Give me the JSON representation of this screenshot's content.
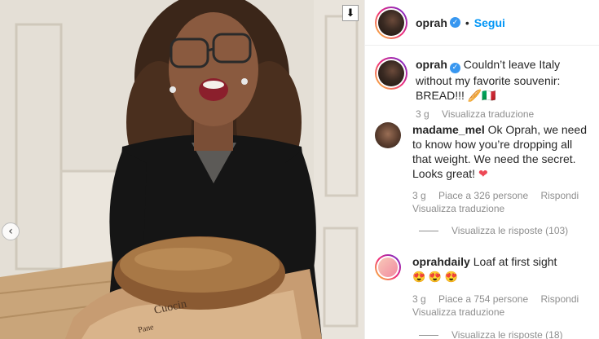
{
  "photo": {
    "prev_icon": "chevron-left-icon",
    "download_icon": "download-arrow-icon",
    "prev_glyph": "‹",
    "download_glyph": "⬇",
    "bag_text": "Cuocin",
    "bag_text2": "Pane"
  },
  "header": {
    "username": "oprah",
    "verified_glyph": "✓",
    "separator": "•",
    "follow_label": "Segui"
  },
  "caption": {
    "username": "oprah",
    "text": "Couldn’t leave Italy without my favorite souvenir: BREAD!!! 🥖🇮🇹",
    "time": "3 g",
    "translate": "Visualizza traduzione"
  },
  "comments": [
    {
      "username": "madame_mel",
      "text": "Ok Oprah, we need to know how you’re dropping all that weight. We need the secret. Looks great!",
      "emoji": "❤",
      "time": "3 g",
      "likes": "Piace a 326 persone",
      "reply": "Rispondi",
      "translate": "Visualizza traduzione",
      "view_replies": "Visualizza le risposte (103)"
    },
    {
      "username": "oprahdaily",
      "text": "Loaf at first sight",
      "emoji": "😍 😍 😍",
      "time": "3 g",
      "likes": "Piace a 754 persone",
      "reply": "Rispondi",
      "translate": "Visualizza traduzione",
      "view_replies": "Visualizza le risposte (18)"
    }
  ],
  "colors": {
    "accent": "#0095f6",
    "verified": "#3897f0",
    "heart": "#ed4956",
    "muted": "#8e8e8e"
  }
}
